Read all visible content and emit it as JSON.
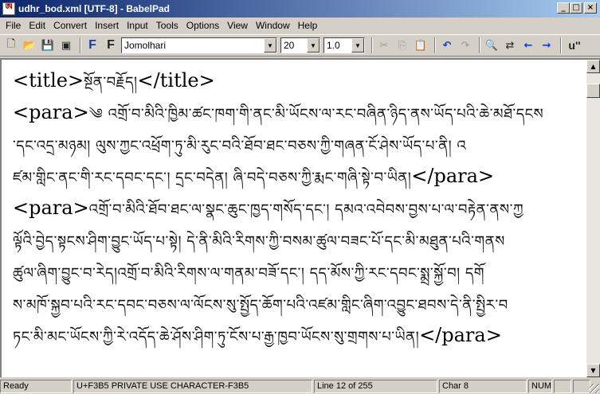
{
  "window": {
    "title": "udhr_bod.xml [UTF-8] - BabelPad",
    "app_icon_glyph": "ཨ",
    "minimize": "_",
    "maximize": "□",
    "close": "×"
  },
  "menu": [
    "File",
    "Edit",
    "Convert",
    "Insert",
    "Input",
    "Tools",
    "Options",
    "View",
    "Window",
    "Help"
  ],
  "toolbar": {
    "font_name": "Jomolhari",
    "font_size": "20",
    "line_spacing": "1.0",
    "format_button_1": "F",
    "format_button_2": "F",
    "unicode_button": "u''"
  },
  "document": {
    "lines": [
      {
        "pre": "<title>",
        "tib": "སྔོན་བརྗོད།",
        "post": "</title>"
      },
      {
        "pre": "<para>",
        "tib": "༄ འགྲོ་བ་མིའི་ཁྱིམ་ཚང་ཁག་གི་ནང་མི་ཡོངས་ལ་རང་བཞིན་ཉིད་ནས་ཡོད་པའི་ཆེ་མཐོ་དངས",
        "post": ""
      },
      {
        "pre": "",
        "tib": "་དང་འདྲ་མཉམ། ལུས་ཀྱང་འཕྲོག་ཏུ་མི་རུང་བའི་ཐོབ་ཐང་བཅས་ཀྱི་གཞན་ངོ་ཤེས་ཡོད་པ་ནི། འ",
        "post": ""
      },
      {
        "pre": "",
        "tib": "ཛམ་གླིང་ནང་གི་རང་དབང་དང་། དྲང་བདེན། ཞི་བདེ་བཅས་ཀྱི་རྨང་གཞི་སྟེ་བ་ཡིན།",
        "post": "</para>"
      },
      {
        "pre": "<para>",
        "tib": "འགྲོ་བ་མིའི་ཐོབ་ཐང་ལ་སྣང་ཆུང་ཁྱད་གསོད་དང་། དམའ་འབེབས་བྱས་པ་ལ་བརྟེན་ནས་ཀྱ",
        "post": ""
      },
      {
        "pre": "",
        "tib": "ལྟོའི་བྱེད་སྟངས་ཤིག་བྱུང་ཡོད་པ་སྟེ། དེ་ནི་མིའི་རིགས་ཀྱི་བསམ་ཚུལ་བཟང་པོ་དང་མི་མཐུན་པའི་གནས",
        "post": ""
      },
      {
        "pre": "",
        "tib": "ཚུལ་ཞིག་བྱུང་བ་རེད།འགྲོ་བ་མིའི་རིགས་ལ་གནམ་བཟོ་དང་། དད་མོས་ཀྱི་རང་དབང་སྨྲ་སྐྱོ་བ། དགོ",
        "post": ""
      },
      {
        "pre": "",
        "tib": "ས་མཁོ་སྐྱབ་པའི་རང་དབང་བཅས་ལ་ལོངས་སུ་སྤྱོད་ཆོག་པའི་འཛམ་གླིང་ཞིག་འབྱུང་ཐབས་དེ་ནི་སྤྱིར་བ",
        "post": ""
      },
      {
        "pre": "",
        "tib": "ཏང་མི་མང་ཡོངས་ཀྱི་རེ་འདོད་ཆེ་ཤོས་ཤིག་ཏུ་ངོས་པ་རྒྱ་ཁྱབ་ཡོངས་སུ་གྲགས་པ་ཡིན།",
        "post": "</para>"
      }
    ]
  },
  "status": {
    "state": "Ready",
    "char_info": "U+F3B5 PRIVATE USE CHARACTER-F3B5",
    "line_info": "Line 12 of 255",
    "char_pos": "Char 8",
    "num": "NUM"
  }
}
